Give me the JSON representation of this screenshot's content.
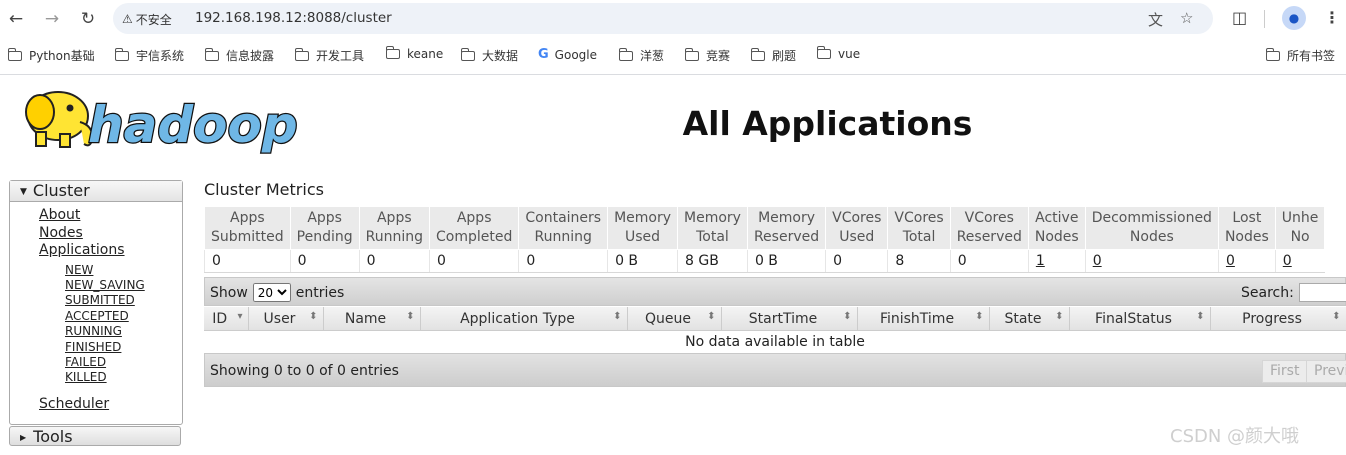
{
  "browser": {
    "security_label": "不安全",
    "url": "192.168.198.12:8088/cluster",
    "bookmarks": [
      "Python基础",
      "宇信系统",
      "信息披露",
      "开发工具",
      "keane",
      "大数据",
      "Google",
      "洋葱",
      "竞赛",
      "刷题",
      "vue"
    ],
    "all_bookmarks": "所有书签"
  },
  "page": {
    "logo_text": "hadoop",
    "title": "All Applications"
  },
  "nav": {
    "cluster_label": "Cluster",
    "about": "About",
    "nodes": "Nodes",
    "applications": "Applications",
    "app_states": [
      "NEW",
      "NEW_SAVING",
      "SUBMITTED",
      "ACCEPTED",
      "RUNNING",
      "FINISHED",
      "FAILED",
      "KILLED"
    ],
    "scheduler": "Scheduler",
    "tools_label": "Tools"
  },
  "metrics": {
    "title": "Cluster Metrics",
    "headers": [
      [
        "Apps",
        "Submitted"
      ],
      [
        "Apps",
        "Pending"
      ],
      [
        "Apps",
        "Running"
      ],
      [
        "Apps",
        "Completed"
      ],
      [
        "Containers",
        "Running"
      ],
      [
        "Memory",
        "Used"
      ],
      [
        "Memory",
        "Total"
      ],
      [
        "Memory",
        "Reserved"
      ],
      [
        "VCores",
        "Used"
      ],
      [
        "VCores",
        "Total"
      ],
      [
        "VCores",
        "Reserved"
      ],
      [
        "Active",
        "Nodes"
      ],
      [
        "Decommissioned",
        "Nodes"
      ],
      [
        "Lost",
        "Nodes"
      ],
      [
        "Unhe",
        "No"
      ]
    ],
    "values": [
      "0",
      "0",
      "0",
      "0",
      "0",
      "0 B",
      "8 GB",
      "0 B",
      "0",
      "8",
      "0",
      "1",
      "0",
      "0",
      "0"
    ]
  },
  "table": {
    "show_label": "Show",
    "entries_label": "entries",
    "page_size": "20",
    "search_label": "Search:",
    "columns": [
      "ID",
      "User",
      "Name",
      "Application Type",
      "Queue",
      "StartTime",
      "FinishTime",
      "State",
      "FinalStatus",
      "Progress"
    ],
    "empty_message": "No data available in table",
    "info": "Showing 0 to 0 of 0 entries",
    "first_label": "First",
    "prev_label": "Previ"
  },
  "watermark": "CSDN @颜大哦"
}
